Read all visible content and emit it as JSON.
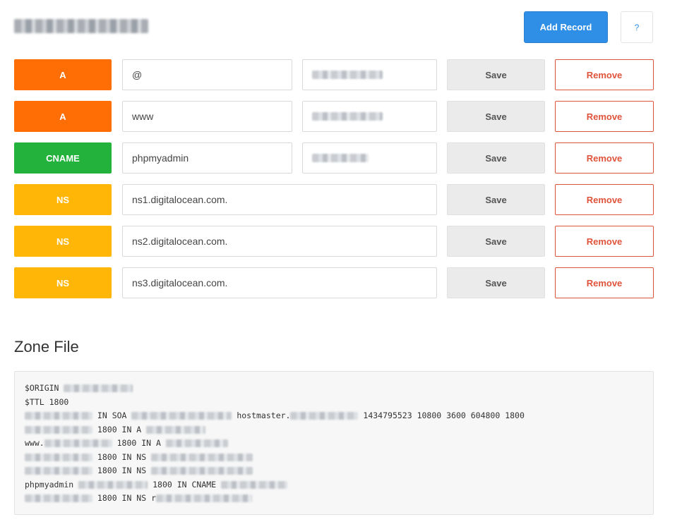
{
  "header": {
    "add_record_label": "Add Record",
    "help_label": "?"
  },
  "colors": {
    "type_A": "#ff6d05",
    "type_CNAME": "#23b33d",
    "type_NS": "#ffb606",
    "primary": "#2f8ee5",
    "danger": "#e0533b"
  },
  "records": [
    {
      "type": "A",
      "name": "@",
      "save": "Save",
      "remove": "Remove"
    },
    {
      "type": "A",
      "name": "www",
      "save": "Save",
      "remove": "Remove"
    },
    {
      "type": "CNAME",
      "name": "phpmyadmin",
      "save": "Save",
      "remove": "Remove"
    },
    {
      "type": "NS",
      "name": "ns1.digitalocean.com.",
      "save": "Save",
      "remove": "Remove"
    },
    {
      "type": "NS",
      "name": "ns2.digitalocean.com.",
      "save": "Save",
      "remove": "Remove"
    },
    {
      "type": "NS",
      "name": "ns3.digitalocean.com.",
      "save": "Save",
      "remove": "Remove"
    }
  ],
  "zone": {
    "heading": "Zone File",
    "l1_a": "$ORIGIN ",
    "l2": "$TTL 1800",
    "l3_b": " IN SOA ",
    "l3_d": " hostmaster.",
    "l3_f": " 1434795523 10800 3600 604800 1800",
    "l4_b": " 1800 IN A ",
    "l5_a": "www.",
    "l5_c": " 1800 IN A ",
    "l6_b": " 1800 IN NS ",
    "l7_b": " 1800 IN NS ",
    "l8_a": "phpmyadmin ",
    "l8_c": " 1800 IN CNAME ",
    "l9_b": " 1800 IN NS r"
  }
}
